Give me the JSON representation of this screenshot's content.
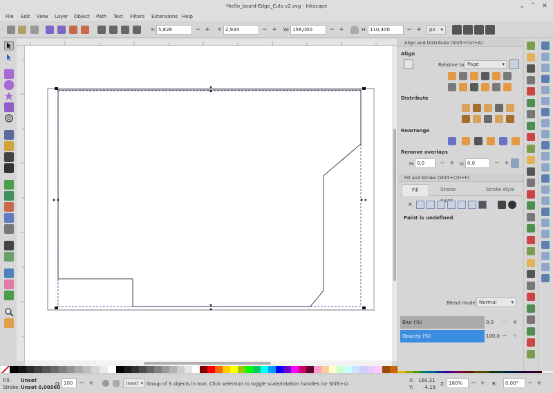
{
  "window": {
    "title": "*hello_board-Edge_Cuts v2.svg - Inkscape"
  },
  "menu": [
    "File",
    "Edit",
    "View",
    "Layer",
    "Object",
    "Path",
    "Text",
    "Filters",
    "Extensions",
    "Help"
  ],
  "toolctl": {
    "x_label": "X:",
    "x_value": "5,826",
    "y_label": "Y:",
    "y_value": "2,934",
    "w_label": "W:",
    "w_value": "156,000",
    "h_label": "H:",
    "h_value": "110,400",
    "unit": "px"
  },
  "align": {
    "header": "Align and Distribute (Shift+Ctrl+A)",
    "section_align": "Align",
    "relative_label": "Relative to:",
    "relative_value": "Page",
    "section_distribute": "Distribute",
    "section_rearrange": "Rearrange",
    "section_overlaps": "Remove overlaps",
    "h_label": "H:",
    "h_value": "0,0",
    "v_label": "V:",
    "v_value": "0,0"
  },
  "fill": {
    "header": "Fill and Stroke (Shift+Ctrl+F)",
    "tabs": [
      "Fill",
      "Stroke paint",
      "Stroke style"
    ],
    "undefined_label": "Paint is undefined",
    "blend_label": "Blend mode:",
    "blend_value": "Normal",
    "blur_label": "Blur (%)",
    "blur_value": "0,0",
    "opacity_label": "Opacity (%)",
    "opacity_value": "100,0"
  },
  "status": {
    "fill_label": "Fill:",
    "fill_value": "Unset",
    "stroke_label": "Stroke:",
    "stroke_value": "Unset 0,00960",
    "o_label": "O:",
    "o_value": "100",
    "layer_value": "(root)",
    "message": "Group of 3 objects in root. Click selection to toggle scale/rotation handles (or Shift+s).",
    "x_label": "X:",
    "x_value": "169,31",
    "y_label": "Y:",
    "y_value": "-4,19",
    "z_label": "Z:",
    "z_value": "180%",
    "r_label": "R:",
    "r_value": "0,00°"
  },
  "colors": {
    "accent": "#3b8de0",
    "selection": "#1a1a8c"
  }
}
